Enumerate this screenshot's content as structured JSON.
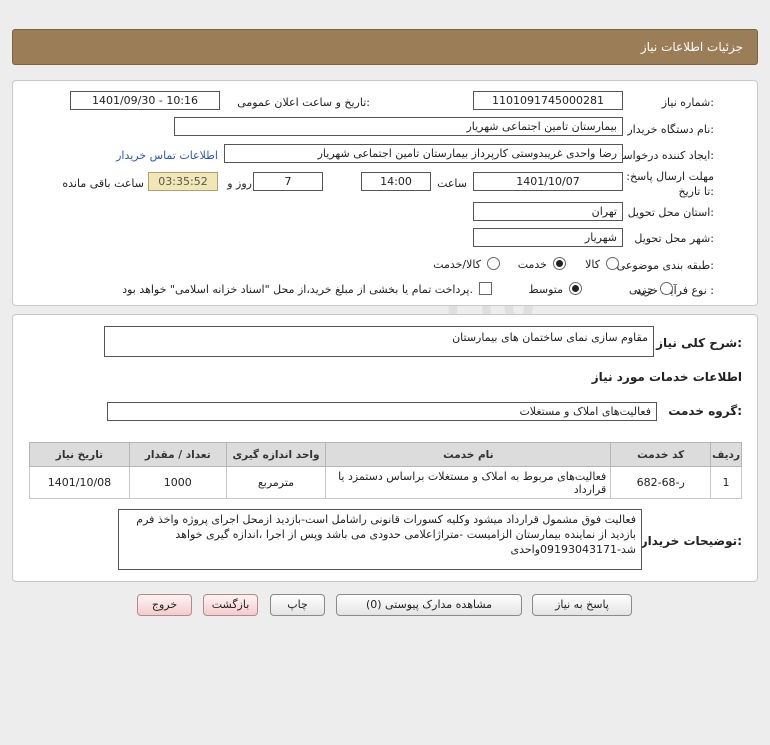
{
  "header": {
    "title": "جزئیات اطلاعات نیاز"
  },
  "form": {
    "need_number_label": "شماره نیاز:",
    "need_number": "1101091745000281",
    "announce_label": "تاریخ و ساعت اعلان عمومی:",
    "announce_value": "1401/09/30 - 10:16",
    "buyer_label": "نام دستگاه خریدار:",
    "buyer_value": "بیمارستان تامین اجتماعی شهریار",
    "creator_label": "ایجاد کننده درخواست:",
    "creator_value": "رضا واحدی غریبدوستی کارپرداز بیمارستان تامین اجتماعی شهریار",
    "contact_link": "اطلاعات تماس خریدار",
    "deadline_label": "مهلت ارسال پاسخ: تا تاریخ:",
    "deadline_date": "1401/10/07",
    "time_label": "ساعت",
    "deadline_time": "14:00",
    "days_value": "7",
    "days_label": "روز و",
    "remaining_time": "03:35:52",
    "remaining_label": "ساعت باقی مانده",
    "province_label": "استان محل تحویل:",
    "province_value": "تهران",
    "city_label": "شهر محل تحویل:",
    "city_value": "شهریار",
    "category_label": "طبقه بندی موضوعی:",
    "category_options": [
      "کالا",
      "خدمت",
      "کالا/خدمت"
    ],
    "category_selected": 1,
    "process_label": "نوع فرآیند خرید :",
    "process_options": [
      "جزیی",
      "متوسط"
    ],
    "process_selected": 1,
    "payment_note": "پرداخت تمام یا بخشی از مبلغ خرید،از محل \"اسناد خزانه اسلامی\" خواهد بود."
  },
  "description": {
    "label": "شرح کلی نیاز:",
    "value": "مقاوم سازی نمای ساختمان های بیمارستان",
    "services_heading": "اطلاعات خدمات مورد نیاز",
    "service_group_label": "گروه خدمت:",
    "service_group_value": "فعالیت‌های  املاک و مستغلات"
  },
  "table": {
    "headers": [
      "ردیف",
      "کد خدمت",
      "نام خدمت",
      "واحد اندازه گیری",
      "تعداد / مقدار",
      "تاریخ نیاز"
    ],
    "rows": [
      [
        "1",
        "ر-68-682",
        "فعالیت‌های مربوط به املاک و مستغلات براساس دستمزد یا قرارداد",
        "مترمربع",
        "1000",
        "1401/10/08"
      ]
    ]
  },
  "buyer_notes": {
    "label": "توضیحات خریدار:",
    "value": "فعالیت فوق مشمول قرارداد میشود وکلیه کسورات قانونی راشامل است-بازدید ازمحل اجرای پروژه واخذ فرم بازدید از نماینده بیمارستان الزامیست -متراژاعلامی حدودی می باشد وپس از اجرا ،اندازه گیری خواهد شد-09193043171واحدی"
  },
  "buttons": {
    "reply": "پاسخ به نیاز",
    "view_docs": "مشاهده مدارک پیوستی (0)",
    "print": "چاپ",
    "back": "بازگشت",
    "exit": "خروج"
  }
}
